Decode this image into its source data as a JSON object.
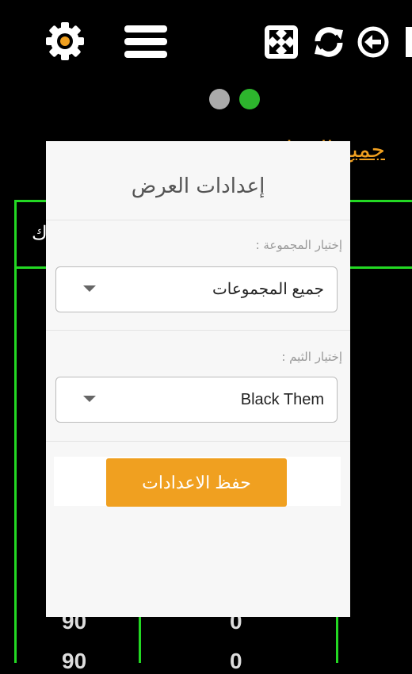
{
  "toolbar": {
    "icons": [
      "gear-icon",
      "menu-icon",
      "expand-icon",
      "refresh-icon",
      "back-icon"
    ]
  },
  "pagination": {
    "count": 2,
    "active": 2
  },
  "background": {
    "title_partial": "جميع المجا",
    "header_partial": "ك",
    "rows": [
      {
        "left": "90",
        "mid": "0"
      },
      {
        "left": "90",
        "mid": "0"
      }
    ]
  },
  "modal": {
    "title": "إعدادات العرض",
    "group_label": "إختيار المجموعة :",
    "group_value": "جميع المجموعات",
    "theme_label": "إختيار الثيم :",
    "theme_value": "Black Them",
    "save_label": "حفظ الاعدادات"
  },
  "colors": {
    "accent": "#f0a020",
    "grid": "#23d823",
    "dot_inactive": "#aaaaaa",
    "dot_active": "#2db52d",
    "modal_bg": "#f7f7f7"
  }
}
